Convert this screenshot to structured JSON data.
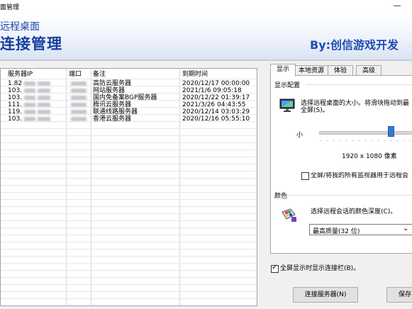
{
  "window": {
    "title": "面管理",
    "minimize_glyph": "—"
  },
  "banner": {
    "subtitle": "远程桌面",
    "title": "连接管理",
    "brand": "By:创信游戏开发"
  },
  "server_table": {
    "columns": [
      "服务器IP",
      "端口",
      "备注",
      "到期时间"
    ],
    "rows": [
      {
        "ip": "1.82",
        "remark": "高防云服务器",
        "expires": "2020/12/17 00:00:00"
      },
      {
        "ip": "103.",
        "remark": "网站服务器",
        "expires": "2021/1/6 09:05:18"
      },
      {
        "ip": "103.",
        "remark": "国内免备案BGP服务器",
        "expires": "2020/12/22 01:39:17"
      },
      {
        "ip": "111.",
        "remark": "腾讯云服务器",
        "expires": "2021/3/26 04:43:55"
      },
      {
        "ip": "119.",
        "remark": "联通线路服务器",
        "expires": "2020/12/14 03:03:29"
      },
      {
        "ip": "103.",
        "remark": "香港云服务器",
        "expires": "2020/12/16 05:55:10"
      }
    ]
  },
  "tabs": [
    "显示",
    "本地资源",
    "体验",
    "高级"
  ],
  "display": {
    "group_title": "显示配置",
    "description": "选择远程桌面的大小。将滑块拖动到最",
    "description2": "全屏(S)。",
    "slider_min_label": "小",
    "slider_value": 0.72,
    "resolution": "1920 x 1080 像素",
    "multi_monitor_label": "全屏/将我的所有监视器用于远程会",
    "multi_monitor_checked": false
  },
  "colors": {
    "group_title": "颜色",
    "description": "选择远程会话的颜色深度(C)。",
    "depth_value": "最高质量(32 位)"
  },
  "show_bar": {
    "label": "全屏显示时显示连接栏(B)。",
    "checked": true
  },
  "buttons": {
    "connect": "连接服务器(N)",
    "save": "保存"
  },
  "accent": "#1f45a8"
}
